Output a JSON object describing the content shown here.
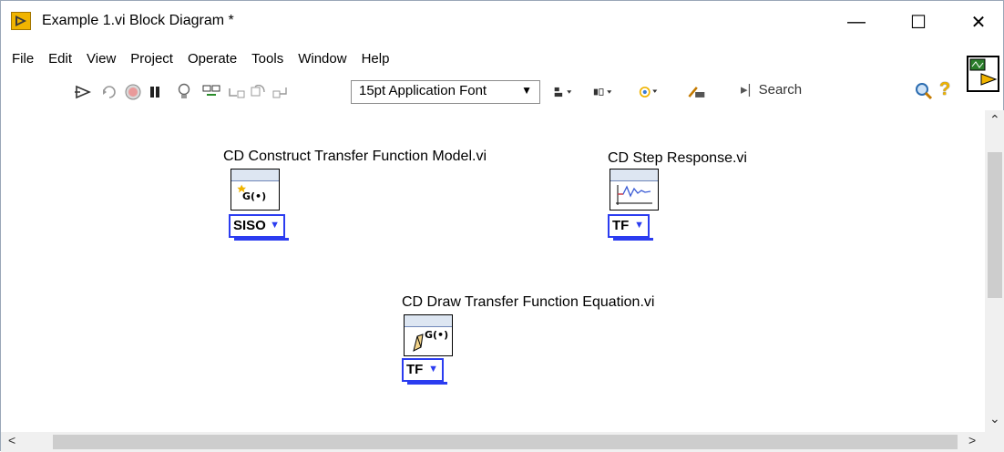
{
  "window": {
    "title": "Example 1.vi Block Diagram *",
    "controls": {
      "minimize": "—",
      "maximize": "☐",
      "close": "✕"
    }
  },
  "menu": [
    "File",
    "Edit",
    "View",
    "Project",
    "Operate",
    "Tools",
    "Window",
    "Help"
  ],
  "toolbar": {
    "font_select": "15pt Application Font",
    "search_label": "Search"
  },
  "diagram": {
    "nodes": [
      {
        "label": "CD Construct Transfer Function Model.vi",
        "glyph": "G(•)",
        "ring": "SISO"
      },
      {
        "label": "CD Step Response.vi",
        "glyph": "",
        "ring": "TF"
      },
      {
        "label": "CD Draw Transfer Function Equation.vi",
        "glyph": "G(•)",
        "ring": "TF"
      }
    ]
  },
  "colors": {
    "ring_border": "#2b3cf0",
    "strip": "#dde6f2",
    "accent_yellow": "#f0b400"
  }
}
